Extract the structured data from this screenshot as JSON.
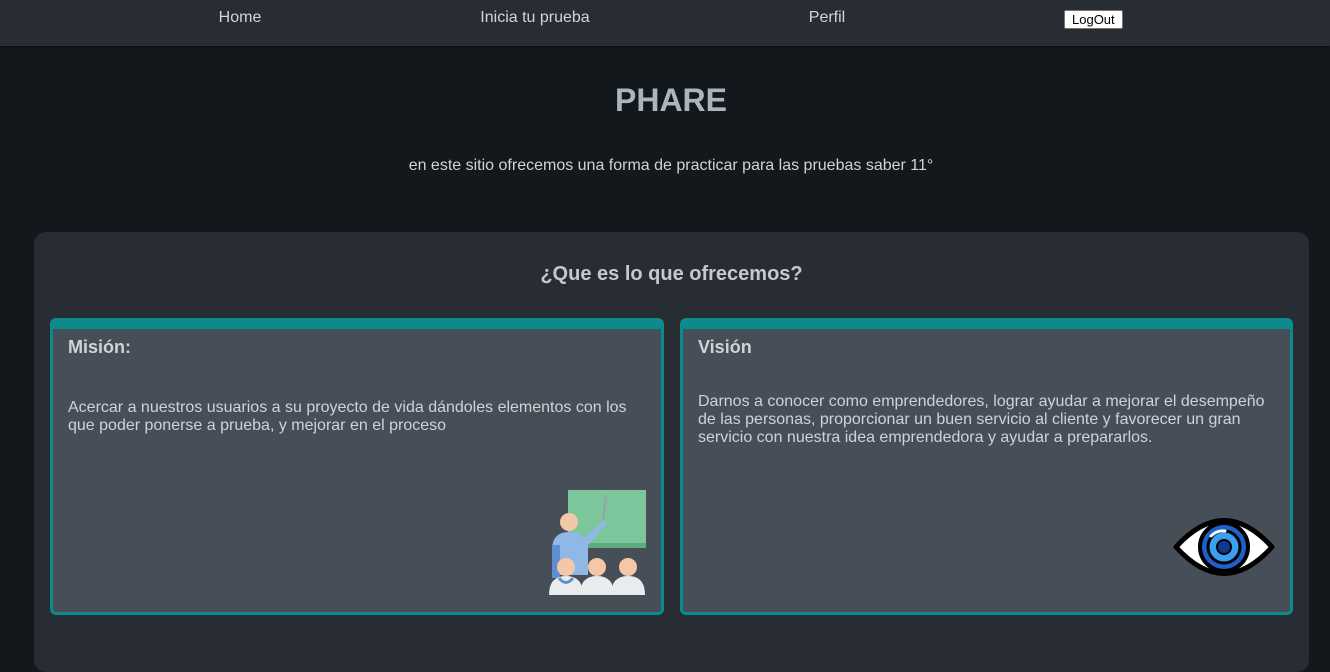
{
  "nav": {
    "links": [
      "Home",
      "Inicia tu prueba",
      "Perfil"
    ],
    "logout_label": "LogOut"
  },
  "hero": {
    "title": "PHARE",
    "subtitle": "en este sitio ofrecemos una forma de practicar para las pruebas saber 11°"
  },
  "offer": {
    "title": "¿Que es lo que ofrecemos?",
    "cards": [
      {
        "title": "Misión:",
        "text": "Acercar a nuestros usuarios a su proyecto de vida dándoles elementos con los que poder ponerse a prueba, y mejorar en el proceso",
        "illustration": "teacher-classroom-illustration"
      },
      {
        "title": "Visión",
        "text": "Darnos a conocer como emprendedores, lograr ayudar a mejorar el desempeño de las personas, proporcionar un buen servicio al cliente y favorecer un gran servicio con nuestra idea emprendedora y ayudar a prepararlos.",
        "illustration": "eye-icon"
      }
    ]
  },
  "colors": {
    "page_bg": "#13181c",
    "nav_bg": "#282d33",
    "panel_bg": "#282d33",
    "card_bg": "#464e57",
    "card_accent": "#0c8a8d",
    "title_text": "#aeb4bf"
  }
}
